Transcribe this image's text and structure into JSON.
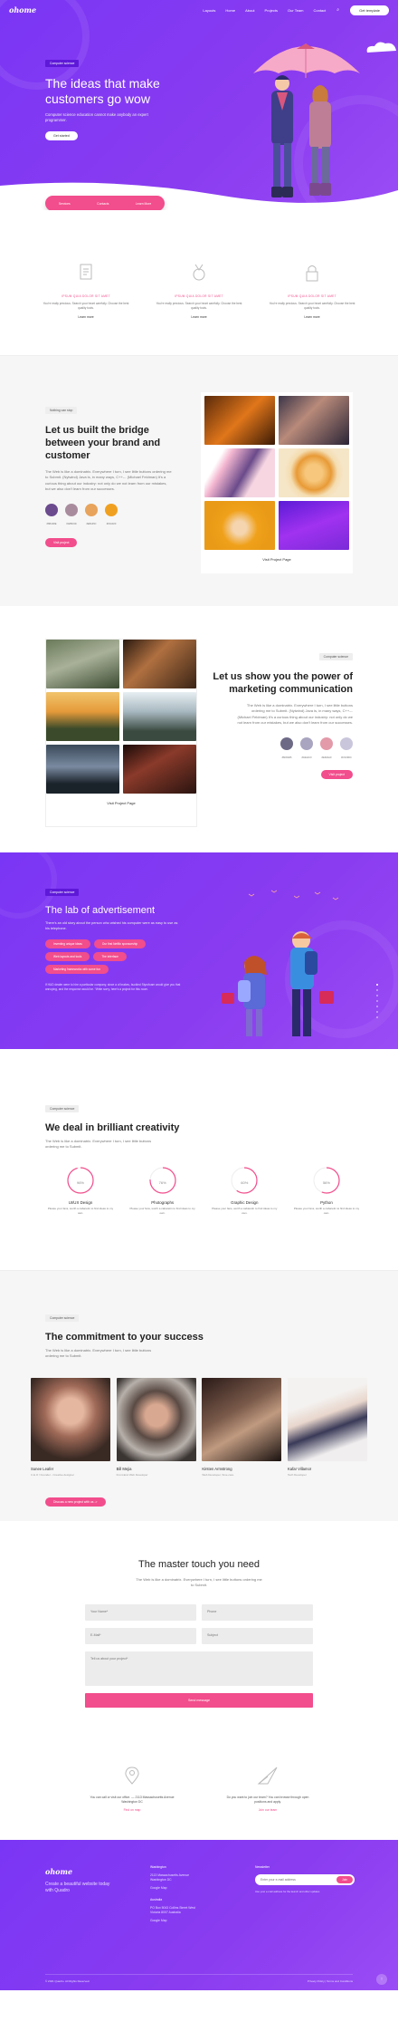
{
  "brand": {
    "logo": "ohome"
  },
  "nav": {
    "items": [
      "Layouts",
      "Home",
      "About",
      "Projects",
      "Our Team",
      "Contact"
    ],
    "cta": "Get template"
  },
  "hero": {
    "tag": "Computer science",
    "title": "The ideas that make customers go wow",
    "subtitle": "Computer science education cannot make anybody an expert programmer.",
    "button": "Get started",
    "bar": [
      "Services",
      "Contacts",
      "Learn More"
    ]
  },
  "features": [
    {
      "icon": "document-icon",
      "label": "Ipsum quia dolor sit amet",
      "text": "You're really precious. Search your heart carefully. Choose the best quality tools.",
      "link": "Learn more"
    },
    {
      "icon": "medal-icon",
      "label": "Ipsum quia dolor sit amet",
      "text": "You're really precious. Search your heart carefully. Choose the best quality tools.",
      "link": "Learn more"
    },
    {
      "icon": "lock-icon",
      "label": "Ipsum quia dolor sit amet",
      "text": "You're really precious. Search your heart carefully. Choose the best quality tools.",
      "link": "Learn more"
    }
  ],
  "bridge": {
    "tag": "Nothing can stop",
    "title": "Let us built the bridge between your brand and customer",
    "text": "The Web is like a dominatrix. Everywhere I turn, I see little buttons ordering me to Submit. (Nytwind) Java is, in many ways, C++--. (Michael Feldman) It's a curious thing about our industry: not only do we not learn from our mistakes, but we also don't learn from our successes.",
    "swatches": [
      {
        "color": "#6b4a8e",
        "label": "#6B4A8E"
      },
      {
        "color": "#a88c9d",
        "label": "#A88C9D"
      },
      {
        "color": "#e8a35c",
        "label": "#E8A35C"
      },
      {
        "color": "#f0a020",
        "label": "#F0A020"
      }
    ],
    "button": "Visit project",
    "gallery_link": "Visit Project Page"
  },
  "marketing": {
    "tag": "Computer science",
    "title": "Let us show you the power of marketing communication",
    "text": "The Web is like a dominatrix. Everywhere I turn, I see little buttons ordering me to Submit. (Nytwind) Java is, in many ways, C++--. (Michael Feldman) It's a curious thing about our industry: not only do we not learn from our mistakes, but we also don't learn from our successes.",
    "swatches": [
      {
        "color": "#6d6a86",
        "label": "#6D6A86"
      },
      {
        "color": "#a9a4c0",
        "label": "#A9A4C0"
      },
      {
        "color": "#e39aa9",
        "label": "#E39AA9"
      },
      {
        "color": "#c9c6dc",
        "label": "#C9C6DC"
      }
    ],
    "button": "Visit project",
    "gallery_link": "Visit Project Page"
  },
  "advert": {
    "tag": "Computer science",
    "title": "The lab of advertisement",
    "intro": "There's an old story about the person who wished his computer were as easy to use as his telephone.",
    "pills": [
      "Inventing unique ideas",
      "Our first Netflix sponsorship",
      "Web layouts and tools",
      "The interface",
      "Dedicated to that!",
      "Marketing frameworks with some fun"
    ],
    "text": "If HUD dealer were to hire a particular company, since a of brakes, buckled Styrofoam would give you that annoying, and the response would be. “Write sorry, here's a project for this room.",
    "dots": 7
  },
  "creativity": {
    "tag": "Computer science",
    "title": "We deal in brilliant creativity",
    "text": "The Web is like a dominatrix. Everywhere I turn, I see little buttons ordering me to Submit.",
    "stats": [
      {
        "value": "96%",
        "pct": 0.96,
        "label": "UI/UX Design",
        "text": "Please your fans, worth a cabaretin to find ideas to my own."
      },
      {
        "value": "76%",
        "pct": 0.76,
        "label": "Photographs",
        "text": "Please your fans, worth a cabaretin to find ideas to my own."
      },
      {
        "value": "60%",
        "pct": 0.6,
        "label": "Graphic Design",
        "text": "Please your fans, worth a cabaretin to find ideas to my own."
      },
      {
        "value": "56%",
        "pct": 0.56,
        "label": "Python",
        "text": "Please your fans, worth a cabaretin to find ideas to my own."
      }
    ]
  },
  "team": {
    "tag": "Computer science",
    "title": "The commitment to your success",
    "text": "The Web is like a dominatrix. Everywhere I turn, I see little buttons ordering me to Submit.",
    "members": [
      {
        "name": "Sunee Leafer",
        "role": "C.E.O / Founder - Creative designer"
      },
      {
        "name": "Bill Mejia",
        "role": "Front-End Web Developer"
      },
      {
        "name": "Kirsten Armstrong",
        "role": "Web Developer, Sine-care"
      },
      {
        "name": "Kafar Villamor",
        "role": "Tech Developer"
      }
    ],
    "button": "Discuss a new project with us ->"
  },
  "contact": {
    "title": "The master touch you need",
    "text": "The Web is like a dominatrix. Everywhere I turn, I see little buttons ordering me to Submit.",
    "fields": {
      "name": "Your Name*",
      "phone": "Phone",
      "email": "E-Mail*",
      "subject": "Subject",
      "message": "Tell us about your project*"
    },
    "submit": "Send message"
  },
  "info": [
    {
      "icon": "location-icon",
      "text": "You can call or visit our office. — 2113 Massachusetts Avenue Washington DC",
      "link": "Find on map"
    },
    {
      "icon": "paper-plane-icon",
      "text": "Do you want to join our team? You can browse through open positions and apply.",
      "link": "Join our team"
    }
  ],
  "footer": {
    "logo": "ohome",
    "tagline": "Create a beautiful website today with Quadro",
    "col1_title": "Washington",
    "col1_lines": [
      "2113 Massachusetts Avenue",
      "Washington DC"
    ],
    "col1_link": "Google Map",
    "col2_title": "Australia",
    "col2_lines": [
      "PO Box 5043 Collins Street West",
      "Victoria 8007 Australia"
    ],
    "col2_link": "Google Map",
    "news_title": "Newsletter",
    "news_placeholder": "Enter your e-mail address",
    "news_button": "Join",
    "news_note": "Use your e-mail address for the launch and other updates",
    "copyright": "© 2021 Quadro. All Rights Reserved.",
    "bottom_right": "Privacy Policy | Terms and Conditions"
  }
}
